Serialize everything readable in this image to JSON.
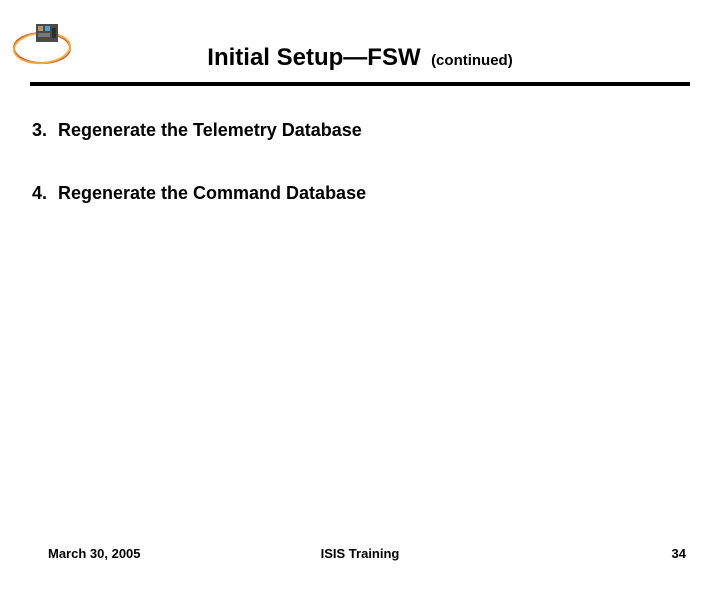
{
  "header": {
    "title": "Initial Setup—FSW",
    "continued": "(continued)"
  },
  "items": [
    {
      "num": "3.",
      "text": "Regenerate the Telemetry Database"
    },
    {
      "num": "4.",
      "text": "Regenerate the Command Database"
    }
  ],
  "footer": {
    "date": "March 30, 2005",
    "center": "ISIS Training",
    "page": "34"
  }
}
